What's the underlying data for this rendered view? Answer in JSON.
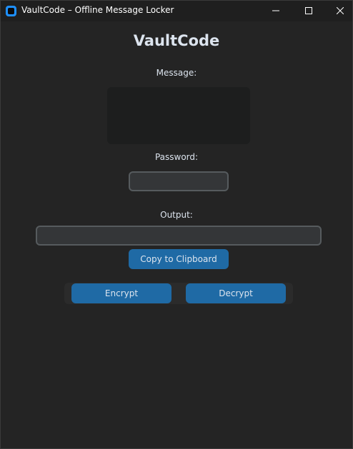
{
  "window": {
    "title": "VaultCode – Offline Message Locker"
  },
  "main": {
    "heading": "VaultCode",
    "message_label": "Message:",
    "message_value": "",
    "password_label": "Password:",
    "password_value": "",
    "output_label": "Output:",
    "output_value": "",
    "copy_button_label": "Copy to Clipboard",
    "encrypt_button_label": "Encrypt",
    "decrypt_button_label": "Decrypt"
  },
  "colors": {
    "background": "#242424",
    "accent": "#1f6aa5",
    "text": "#dce4ee",
    "entry_background": "#343638",
    "entry_border": "#565b5e"
  },
  "icons": {
    "app": "app-icon",
    "minimize": "minimize-icon",
    "maximize": "maximize-icon",
    "close": "close-icon"
  }
}
